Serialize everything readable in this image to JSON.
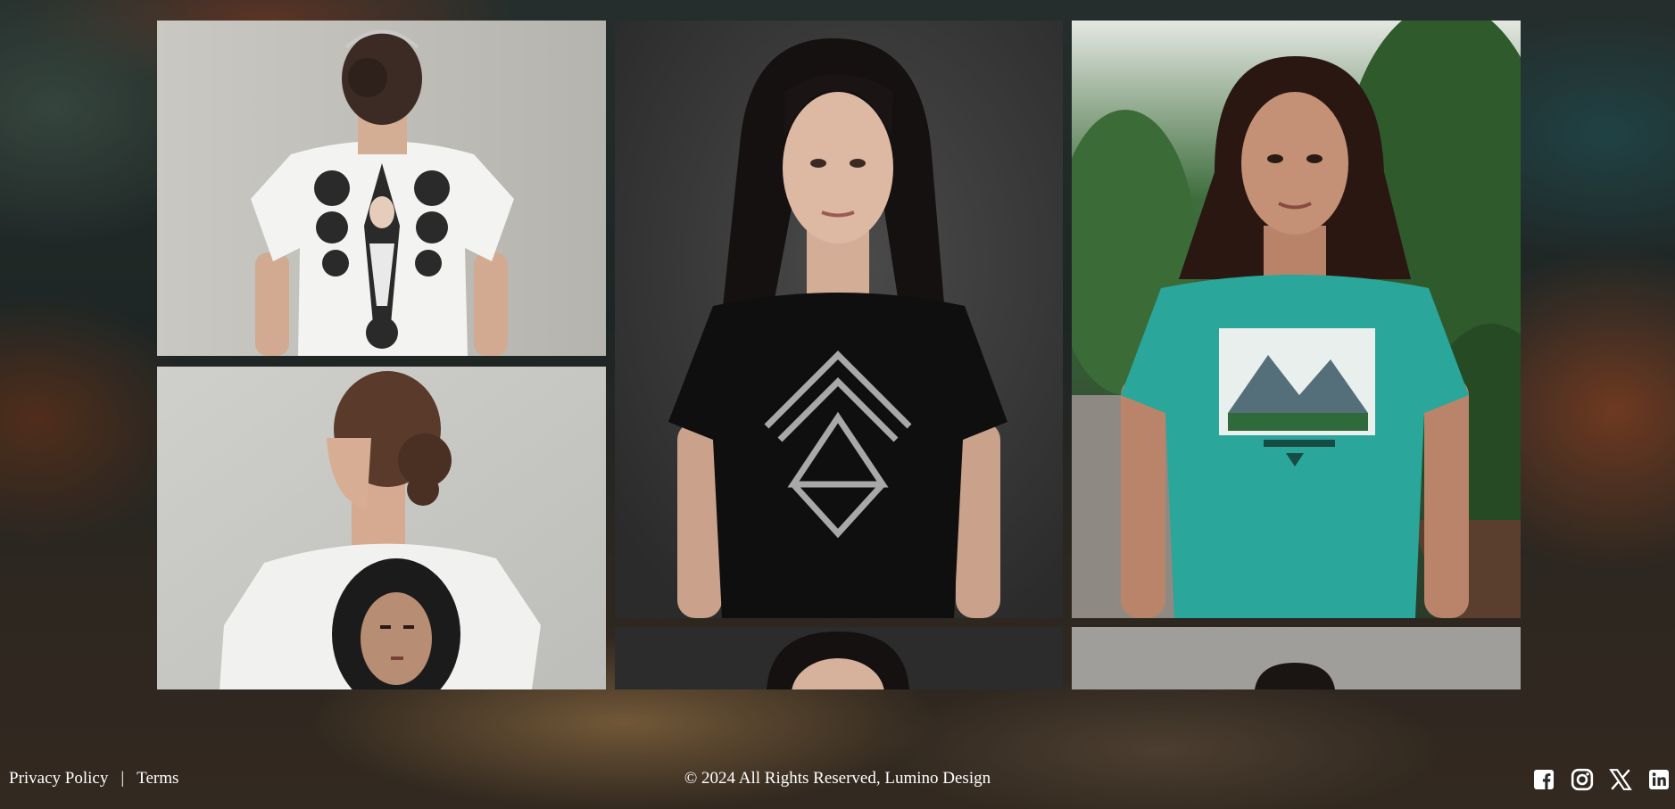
{
  "footer": {
    "privacy_label": "Privacy Policy",
    "separator": "|",
    "terms_label": "Terms",
    "copyright": "© 2024 All Rights Reserved, Lumino Design"
  },
  "social": [
    "facebook-icon",
    "instagram-icon",
    "x-icon",
    "linkedin-icon"
  ],
  "colors": {
    "text": "#ffffff",
    "teal_shirt": "#2aa69b",
    "black_shirt": "#101010",
    "white_shirt": "#f2f2f2"
  }
}
